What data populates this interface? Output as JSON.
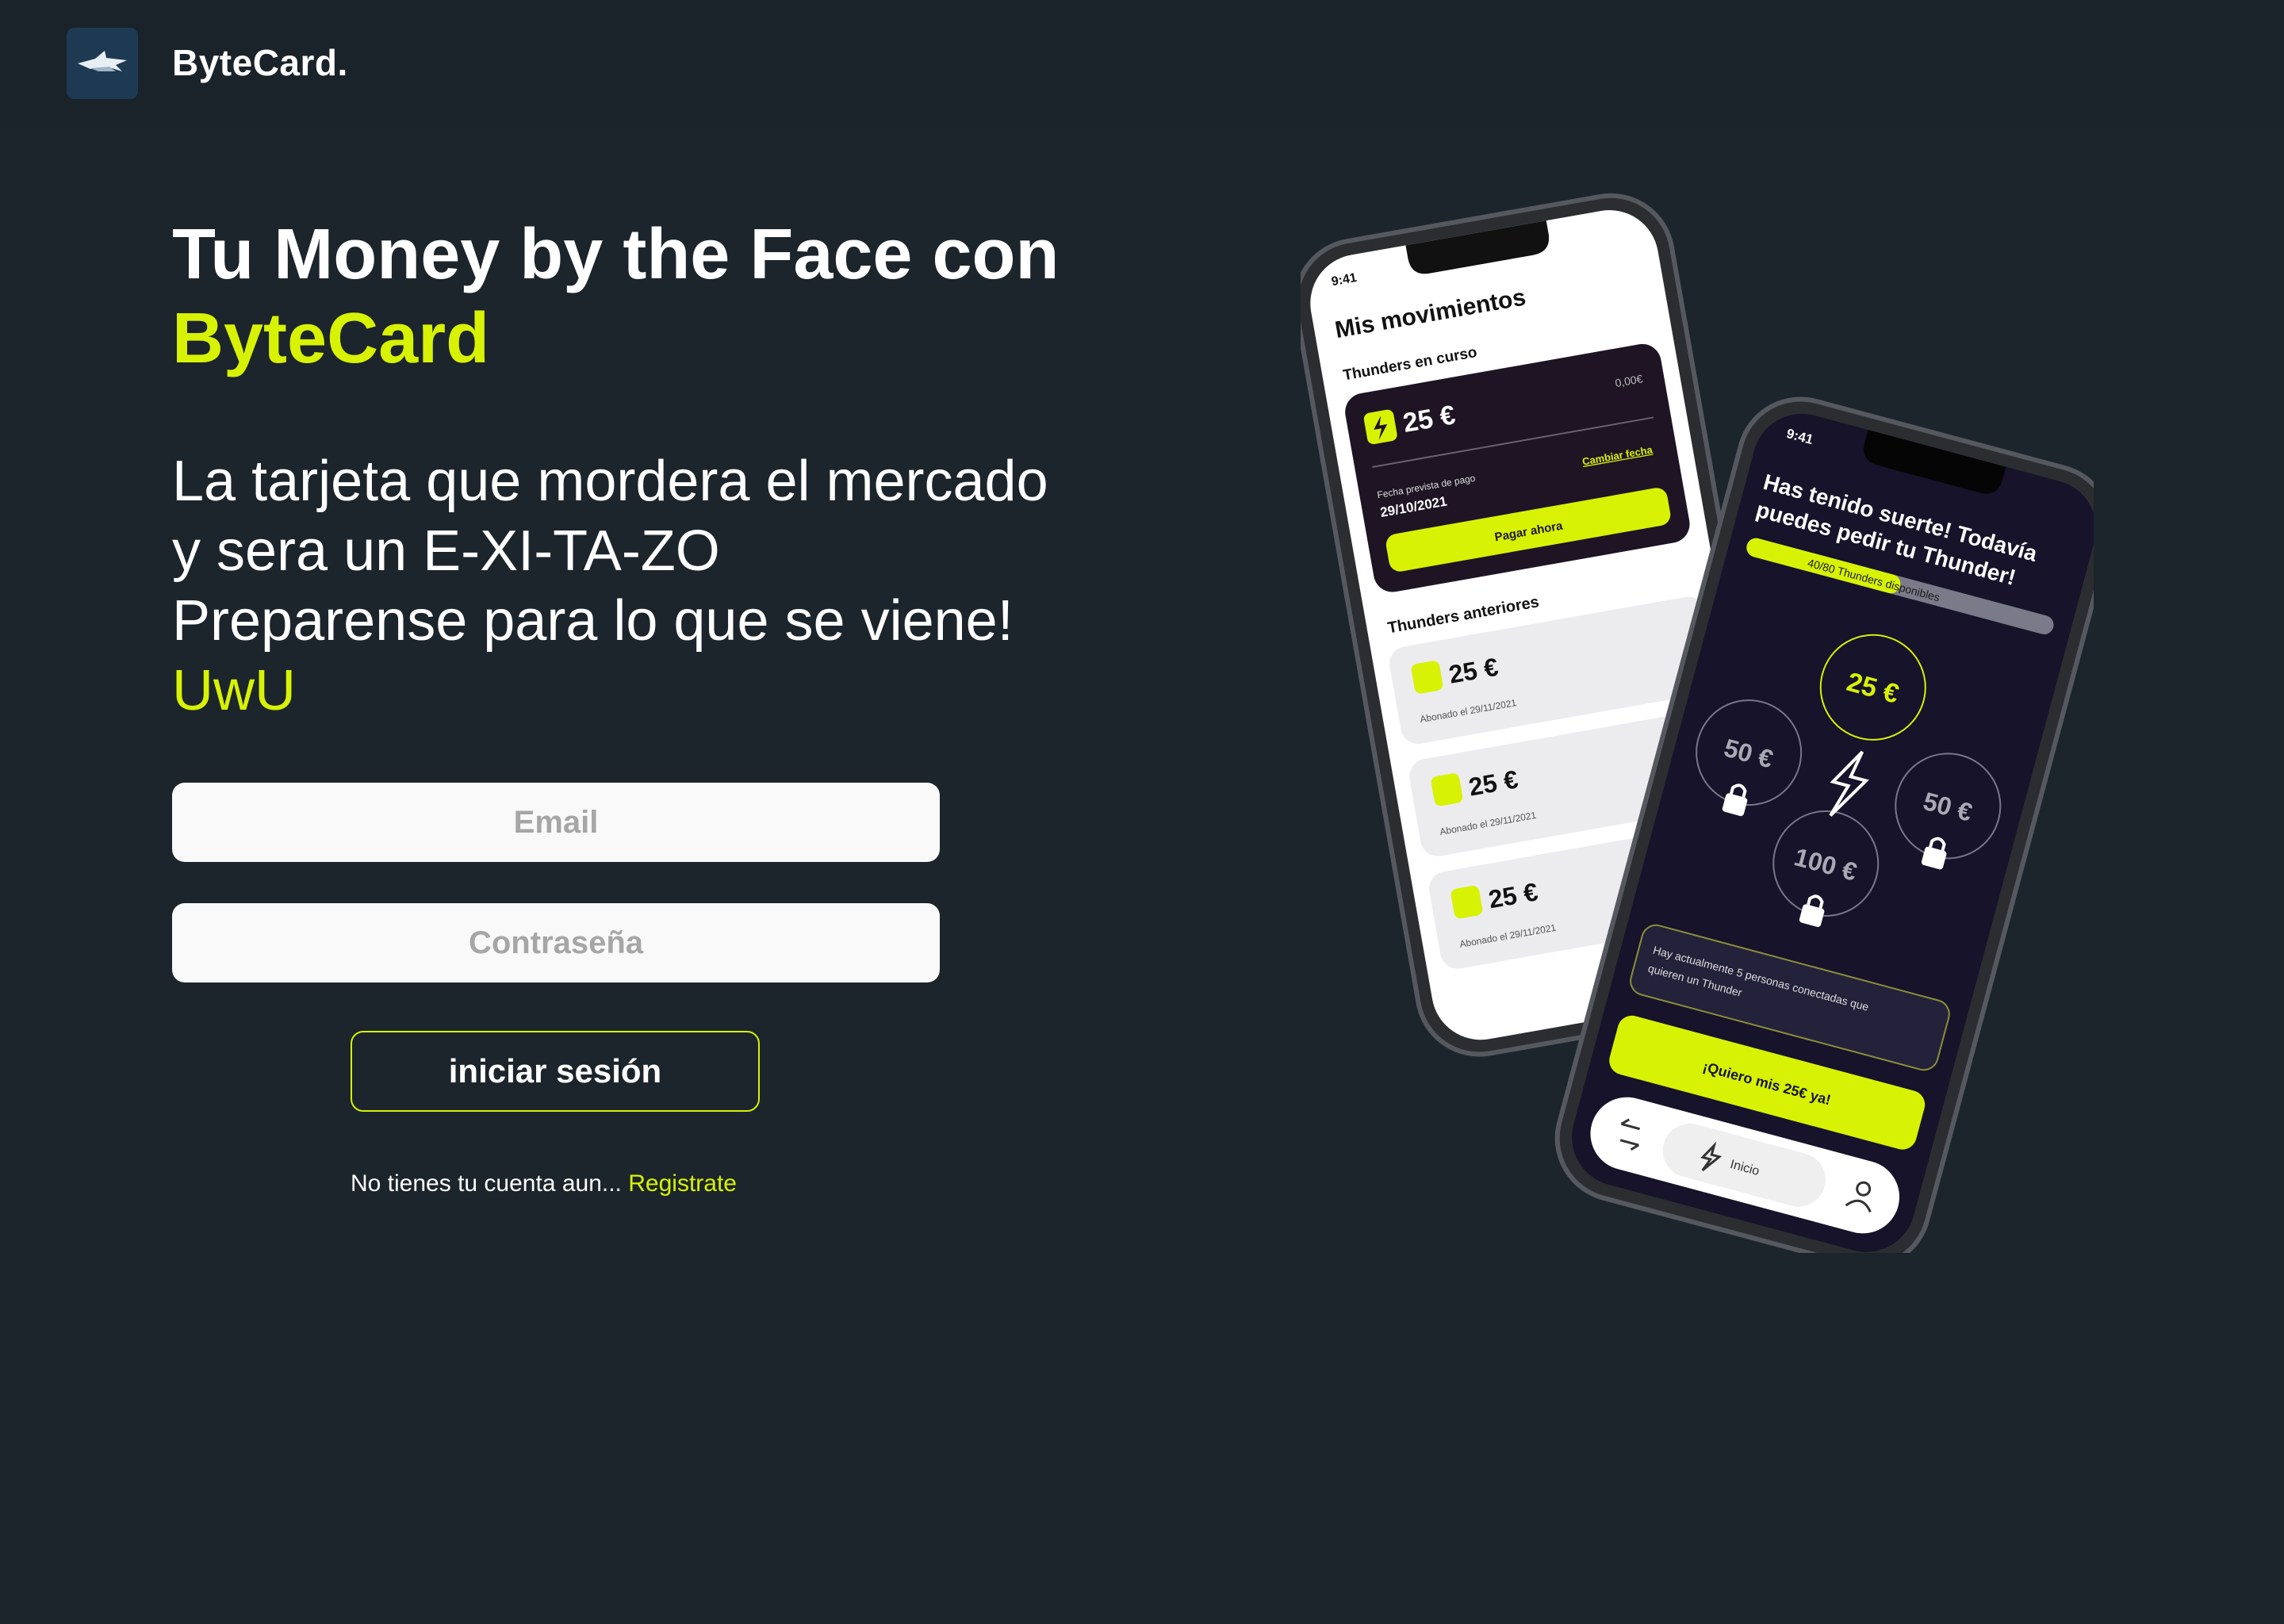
{
  "header": {
    "brand": "ByteCard.",
    "logo_icon": "shark-logo-icon"
  },
  "hero": {
    "title_main": "Tu Money by the Face con",
    "title_accent": "ByteCard",
    "tagline_lines": [
      "La tarjeta que mordera el mercado",
      "y sera un E-XI-TA-ZO",
      "Preparense para lo que se viene!"
    ],
    "tagline_accent": "UwU"
  },
  "form": {
    "email_placeholder": "Email",
    "password_placeholder": "Contraseña",
    "login_label": "iniciar sesión",
    "signup_prefix": "No tienes tu cuenta aun...",
    "signup_link": "Registrate"
  },
  "phone_left": {
    "time": "9:41",
    "title": "Mis movimientos",
    "section_current": "Thunders en curso",
    "current_amount": "25 €",
    "current_pending": "0,00€",
    "due_label": "Fecha prevista de pago",
    "due_date": "29/10/2021",
    "change_date": "Cambiar fecha",
    "pay_now": "Pagar ahora",
    "section_past": "Thunders anteriores",
    "past_items": [
      {
        "amount": "25 €",
        "paid": "Abonado el 29/11/2021"
      },
      {
        "amount": "25 €",
        "paid": "Abonado el 29/11/2021"
      },
      {
        "amount": "25 €",
        "paid": "Abonado el 29/11/2021"
      }
    ]
  },
  "phone_right": {
    "time": "9:41",
    "headline_1": "Has tenido suerte! Todavía",
    "headline_2": "puedes pedir tu Thunder!",
    "progress_label": "40/80 Thunders disponibles",
    "progress_value": 0.5,
    "amount_25": "25 €",
    "amount_50_left": "50 €",
    "amount_50_right": "50 €",
    "amount_100": "100 €",
    "connected_1": "Hay actualmente 5 personas conectadas que",
    "connected_2": "quieren un Thunder",
    "cta": "¡Quiero mis 25€ ya!",
    "nav_home": "Inicio"
  },
  "colors": {
    "accent": "#d7f205",
    "background": "#1c252b",
    "header": "#1a2329"
  }
}
